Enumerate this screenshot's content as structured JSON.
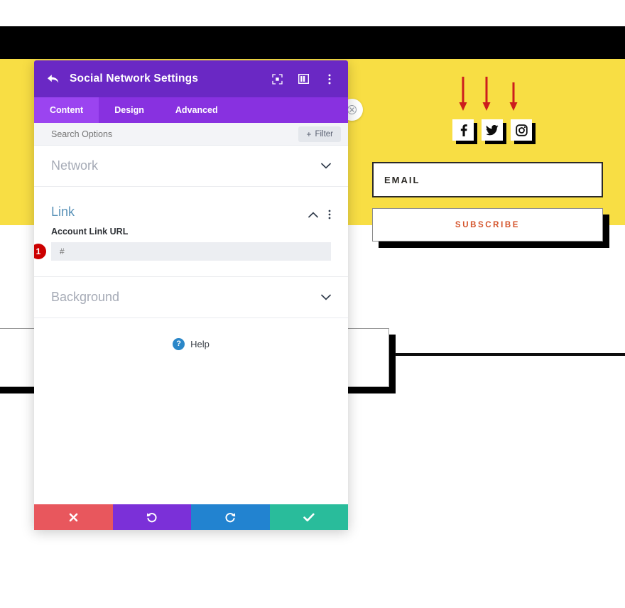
{
  "site": {
    "social_icons": [
      {
        "name": "facebook-icon",
        "label": "Facebook"
      },
      {
        "name": "twitter-icon",
        "label": "Twitter"
      },
      {
        "name": "instagram-icon",
        "label": "Instagram"
      }
    ],
    "arrow_count": 3,
    "arrow_color": "#cc1d1d",
    "email_label": "EMAIL",
    "subscribe_label": "SUBSCRIBE",
    "yellow": "#f8de44",
    "subscribe_text_color": "#d4532a"
  },
  "modal": {
    "title": "Social Network Settings",
    "back_icon": "back-arrow-icon",
    "header_icons": [
      {
        "name": "fullscreen-icon"
      },
      {
        "name": "layout-columns-icon"
      },
      {
        "name": "kebab-menu-icon"
      }
    ],
    "tabs": [
      {
        "label": "Content",
        "active": true
      },
      {
        "label": "Design",
        "active": false
      },
      {
        "label": "Advanced",
        "active": false
      }
    ],
    "search": {
      "placeholder": "Search Options",
      "value": ""
    },
    "filter_label": "Filter",
    "sections": [
      {
        "title": "Network",
        "open": false
      },
      {
        "title": "Link",
        "open": true
      },
      {
        "title": "Background",
        "open": false
      }
    ],
    "link_section": {
      "field_label": "Account Link URL",
      "field_value": "",
      "field_placeholder": "#",
      "step_badge": "1"
    },
    "help_label": "Help",
    "footer_buttons": [
      {
        "name": "discard-button",
        "icon": "close-x-icon",
        "color": "#e8575d"
      },
      {
        "name": "undo-button",
        "icon": "undo-icon",
        "color": "#7b30d8"
      },
      {
        "name": "redo-button",
        "icon": "redo-icon",
        "color": "#2283d0"
      },
      {
        "name": "save-button",
        "icon": "check-icon",
        "color": "#29bc9b"
      }
    ],
    "colors": {
      "header": "#6a28c4",
      "tabs": "#8831e0",
      "tab_active": "#9b44f0",
      "badge": "#cc0000",
      "section_open_title": "#5b93b8"
    }
  }
}
